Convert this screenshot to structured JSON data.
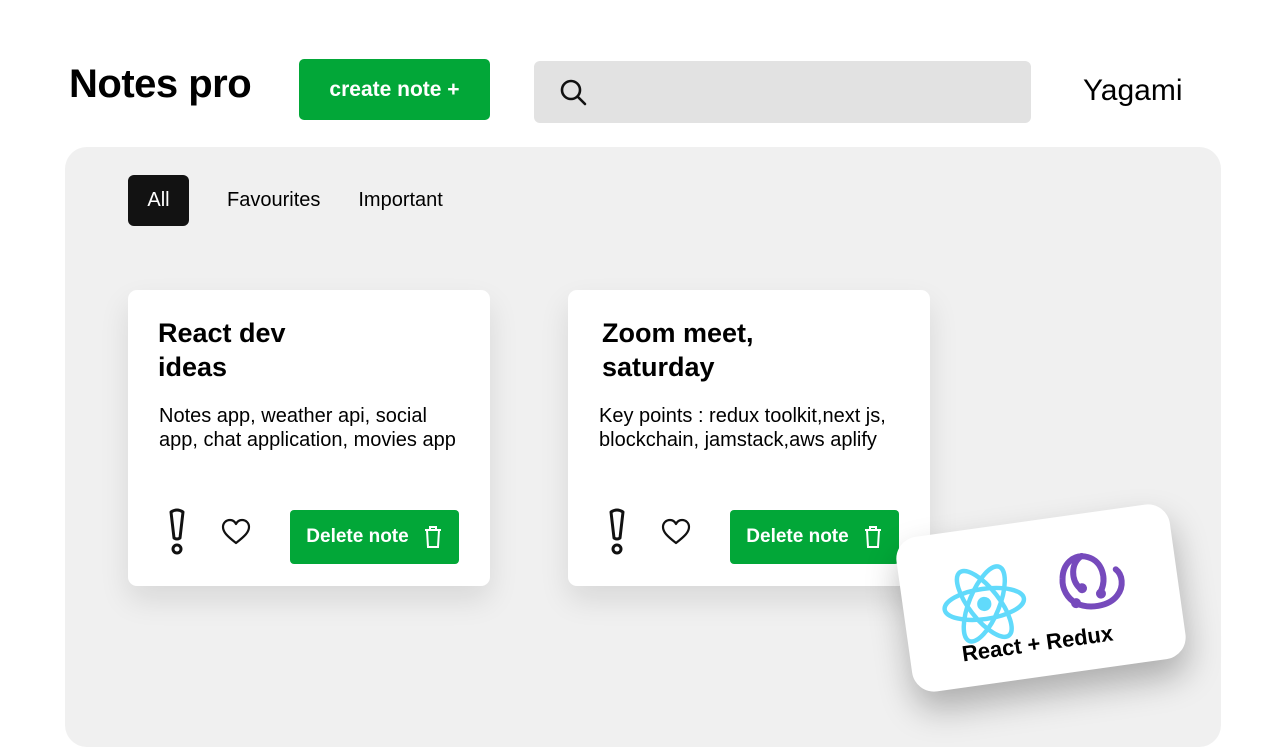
{
  "header": {
    "app_title": "Notes pro",
    "create_label": "create note +",
    "search": {
      "placeholder": "",
      "value": "",
      "icon": "search-icon"
    },
    "username": "Yagami"
  },
  "filters": [
    {
      "label": "All",
      "active": true
    },
    {
      "label": "Favourites",
      "active": false
    },
    {
      "label": "Important",
      "active": false
    }
  ],
  "notes": [
    {
      "title": "React dev ideas",
      "body": "Notes app, weather api, social app, chat application, movies app",
      "delete_label": "Delete note",
      "icons": [
        "exclamation-icon",
        "heart-icon",
        "trash-icon"
      ]
    },
    {
      "title": "Zoom meet, saturday",
      "body": "Key points : redux toolkit,next js, blockchain, jamstack,aws aplify",
      "delete_label": "Delete note",
      "icons": [
        "exclamation-icon",
        "heart-icon",
        "trash-icon"
      ]
    }
  ],
  "badge": {
    "text": "React + Redux",
    "icons": [
      "react-logo",
      "redux-logo"
    ]
  },
  "colors": {
    "accent_green": "#02a738",
    "active_filter": "#121212",
    "board_bg": "#f0f0f0",
    "search_bg": "#e2e2e2",
    "react_blue": "#61dafb",
    "redux_purple": "#764abc"
  }
}
